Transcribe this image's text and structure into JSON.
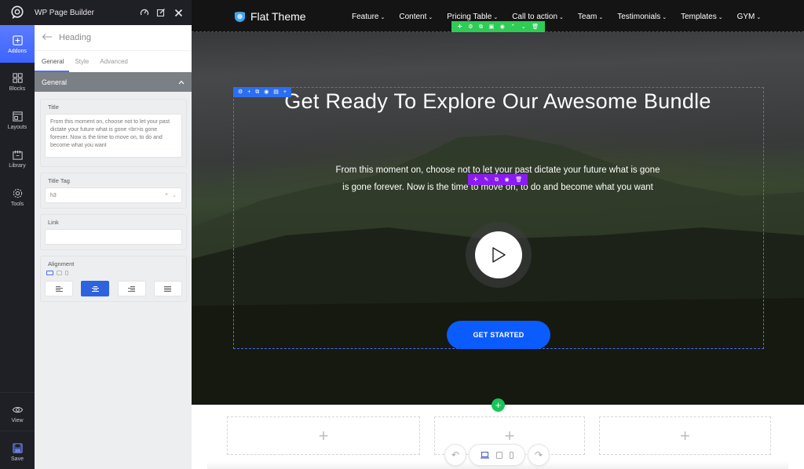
{
  "app": {
    "title": "WP Page Builder",
    "collapse_label": "‹"
  },
  "rail": {
    "items": [
      {
        "label": "Addons",
        "icon": "plus-square-icon",
        "active": true
      },
      {
        "label": "Blocks",
        "icon": "blocks-icon"
      },
      {
        "label": "Layouts",
        "icon": "layouts-icon"
      },
      {
        "label": "Library",
        "icon": "library-icon"
      },
      {
        "label": "Tools",
        "icon": "gear-icon"
      }
    ],
    "bottom": [
      {
        "label": "View",
        "icon": "eye-icon"
      },
      {
        "label": "Save",
        "icon": "save-icon"
      }
    ]
  },
  "topbar": {
    "icons": [
      "speedometer-icon",
      "edit-icon",
      "close-icon"
    ]
  },
  "panel": {
    "back_label": "Heading",
    "tabs": [
      {
        "label": "General",
        "active": true
      },
      {
        "label": "Style"
      },
      {
        "label": "Advanced"
      }
    ],
    "section_title": "General",
    "fields": {
      "title_label": "Title",
      "title_value": "From this moment on, choose not to let your past dictate your future what is gone <br>is gone forever. Now is the time to move on, to do and become what you want",
      "title_tag_label": "Title Tag",
      "title_tag_value": "h3",
      "link_label": "Link",
      "link_value": "",
      "alignment_label": "Alignment",
      "alignment_options": [
        "left",
        "center",
        "right",
        "justify"
      ],
      "alignment_selected": "center"
    }
  },
  "site": {
    "brand": "Flat Theme",
    "nav": [
      {
        "label": "Feature"
      },
      {
        "label": "Content"
      },
      {
        "label": "Pricing Table"
      },
      {
        "label": "Call to action"
      },
      {
        "label": "Team"
      },
      {
        "label": "Testimonials"
      },
      {
        "label": "Templates"
      },
      {
        "label": "GYM"
      }
    ],
    "nav_chevron": "⌄"
  },
  "toolbars": {
    "row": [
      "✛",
      "⚙",
      "⧉",
      "▣",
      "◉",
      "⌃",
      "⌄",
      "🗑"
    ],
    "column": [
      "⚙",
      "+",
      "⧉",
      "◉",
      "▤",
      "+"
    ],
    "element": [
      "✛",
      "✎",
      "⧉",
      "◉",
      "🗑"
    ]
  },
  "hero": {
    "title": "Get Ready To Explore Our Awesome Bundle",
    "subtitle_line1": "From this moment on, choose not to let your past dictate your future what is gone",
    "subtitle_line2": "is gone forever. Now is the time to move on, to do and become what you want",
    "cta_label": "GET STARTED"
  },
  "builder": {
    "add_row": "+",
    "empty_col_plus": "+",
    "undo": "↶",
    "redo": "↷",
    "devices": [
      "desktop",
      "tablet",
      "mobile"
    ],
    "device_selected": "desktop"
  },
  "colors": {
    "accent": "#4a6cf7",
    "row_toolbar": "#2ecc55",
    "column_toolbar": "#2b6ff0",
    "element_toolbar": "#8a1cf2",
    "cta": "#0b5cff",
    "rail_bg": "#1f1f26"
  }
}
